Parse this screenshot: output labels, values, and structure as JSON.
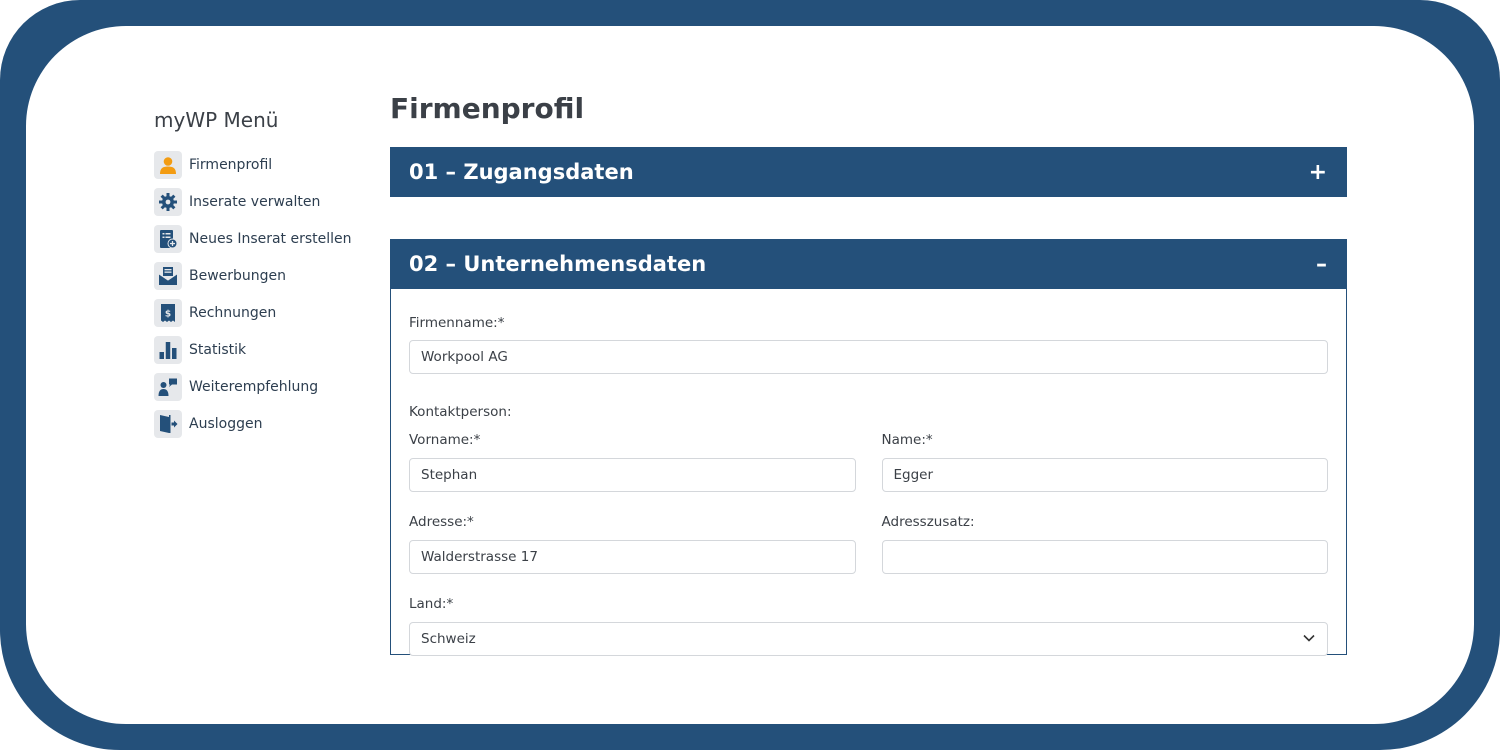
{
  "sidebar": {
    "title": "myWP Menü",
    "items": [
      {
        "label": "Firmenprofil",
        "icon": "user-icon"
      },
      {
        "label": "Inserate verwalten",
        "icon": "gear-icon"
      },
      {
        "label": "Neues Inserat erstellen",
        "icon": "new-listing-icon"
      },
      {
        "label": "Bewerbungen",
        "icon": "envelope-icon"
      },
      {
        "label": "Rechnungen",
        "icon": "invoice-icon"
      },
      {
        "label": "Statistik",
        "icon": "bar-chart-icon"
      },
      {
        "label": "Weiterempfehlung",
        "icon": "recommend-icon"
      },
      {
        "label": "Ausloggen",
        "icon": "logout-door-icon"
      }
    ]
  },
  "main": {
    "title": "Firmenprofil",
    "sections": [
      {
        "title": "01 – Zugangsdaten",
        "toggle": "+"
      },
      {
        "title": "02 – Unternehmensdaten",
        "toggle": "–"
      }
    ],
    "form": {
      "company_label": "Firmenname:*",
      "company_value": "Workpool AG",
      "contact_label": "Kontaktperson:",
      "firstname_label": "Vorname:*",
      "firstname_value": "Stephan",
      "lastname_label": "Name:*",
      "lastname_value": "Egger",
      "address_label": "Adresse:*",
      "address_value": "Walderstrasse 17",
      "address2_label": "Adresszusatz:",
      "address2_value": "",
      "country_label": "Land:*",
      "country_value": "Schweiz"
    }
  },
  "colors": {
    "brand": "#24507a",
    "user_icon_accent": "#f39c12"
  }
}
